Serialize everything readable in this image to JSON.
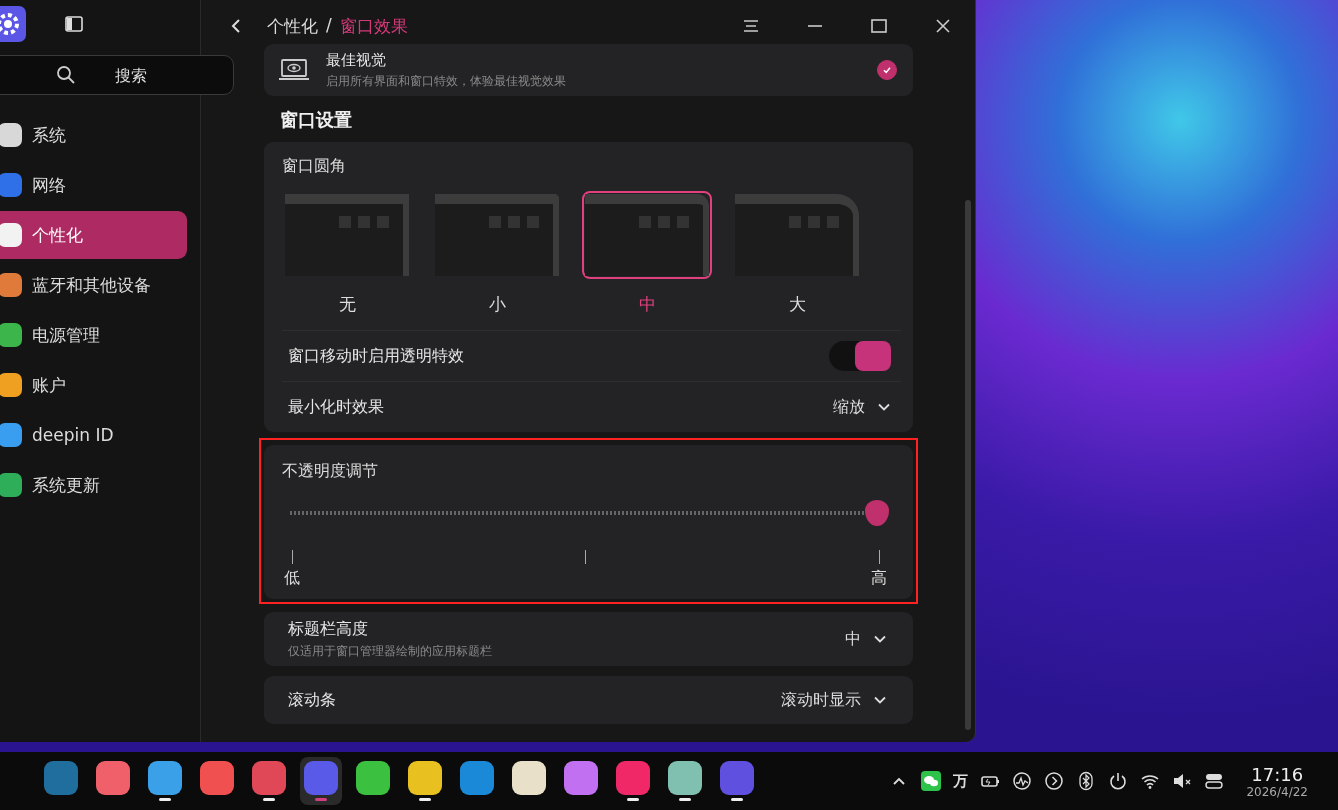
{
  "sidebar": {
    "search": {
      "placeholder": "搜索"
    },
    "items": [
      {
        "label": "系统",
        "selected": false,
        "color": "#d8d8d8"
      },
      {
        "label": "网络",
        "selected": false,
        "color": "#2f6fe8"
      },
      {
        "label": "个性化",
        "selected": true,
        "color": "#f2f2f2"
      },
      {
        "label": "蓝牙和其他设备",
        "selected": false,
        "color": "#e07a3a"
      },
      {
        "label": "电源管理",
        "selected": false,
        "color": "#3cb54a"
      },
      {
        "label": "账户",
        "selected": false,
        "color": "#f0a020"
      },
      {
        "label": "deepin ID",
        "selected": false,
        "color": "#3a9ef0"
      },
      {
        "label": "系统更新",
        "selected": false,
        "color": "#2fae5a"
      }
    ]
  },
  "breadcrumb": [
    {
      "label": "个性化",
      "selected": false
    },
    {
      "label": "/",
      "selected": false
    },
    {
      "label": "窗口效果",
      "selected": true
    }
  ],
  "effect_card": {
    "title": "最佳视觉",
    "description": "启用所有界面和窗口特效，体验最佳视觉效果",
    "checked": true
  },
  "section_title": "窗口设置",
  "corner": {
    "title": "窗口圆角",
    "options": [
      {
        "label": "无",
        "selected": false
      },
      {
        "label": "小",
        "selected": false
      },
      {
        "label": "中",
        "selected": true
      },
      {
        "label": "大",
        "selected": false
      }
    ]
  },
  "transparency_toggle": {
    "label": "窗口移动时启用透明特效",
    "on": true
  },
  "minimize": {
    "label": "最小化时效果",
    "value": "缩放"
  },
  "opacity": {
    "title": "不透明度调节",
    "level": 1.0,
    "highlighted": true,
    "ticks": {
      "low": "低",
      "high": "高"
    }
  },
  "titlebar": {
    "label": "标题栏高度",
    "description": "仅适用于窗口管理器绘制的应用标题栏",
    "value": "中"
  },
  "scrollbar": {
    "label": "滚动条",
    "value": "滚动时显示"
  },
  "dock": [
    {
      "color": "#1f6e9e",
      "running": false,
      "active": false
    },
    {
      "color": "#f0606a",
      "running": false,
      "active": false
    },
    {
      "color": "#3aa0e8",
      "running": true,
      "active": false
    },
    {
      "color": "#f05050",
      "running": false,
      "active": false
    },
    {
      "color": "#e04858",
      "running": true,
      "active": false
    },
    {
      "color": "#5a5ae8",
      "running": true,
      "active": true
    },
    {
      "color": "#3cc040",
      "running": false,
      "active": false
    },
    {
      "color": "#e8c020",
      "running": true,
      "active": false
    },
    {
      "color": "#1a8ad8",
      "running": false,
      "active": false
    },
    {
      "color": "#e8e0c8",
      "running": false,
      "active": false
    },
    {
      "color": "#c070f0",
      "running": false,
      "active": false
    },
    {
      "color": "#f02868",
      "running": true,
      "active": false
    },
    {
      "color": "#80c0b0",
      "running": true,
      "active": false
    },
    {
      "color": "#6050e0",
      "running": true,
      "active": false
    }
  ],
  "tray": {
    "ime": "万",
    "time": "17:16",
    "date": "2026/4/22"
  }
}
